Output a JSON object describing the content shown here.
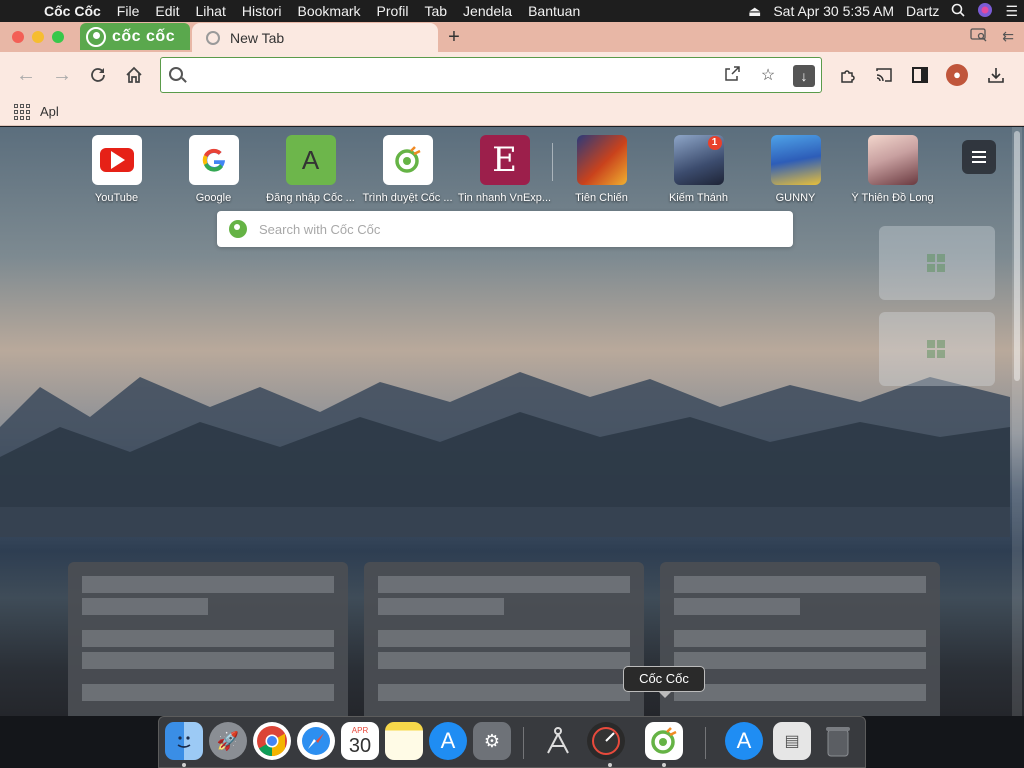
{
  "menubar": {
    "app_name": "Cốc Cốc",
    "items": [
      "File",
      "Edit",
      "Lihat",
      "Histori",
      "Bookmark",
      "Profil",
      "Tab",
      "Jendela",
      "Bantuan"
    ],
    "datetime": "Sat Apr 30  5:35 AM",
    "user": "Dartz"
  },
  "browser": {
    "brand_label": "cốc cốc",
    "tab_title": "New Tab",
    "address_value": "",
    "bookmark_apps_label": "Apl"
  },
  "new_tab": {
    "tiles": [
      {
        "label": "YouTube",
        "icon": "youtube-icon",
        "color": "#ffffff"
      },
      {
        "label": "Google",
        "icon": "google-icon",
        "color": "#ffffff"
      },
      {
        "label": "Đăng nhập Cốc ...",
        "letter": "A",
        "color": "#6db64b"
      },
      {
        "label": "Trình duyệt Cốc ...",
        "icon": "coccoc-icon",
        "color": "#ffffff"
      },
      {
        "label": "Tin nhanh VnExp...",
        "letter": "E",
        "color": "#9c1f4b"
      },
      {
        "label": "Tiên Chiến",
        "icon": "game-icon",
        "color": "#7a2a1a"
      },
      {
        "label": "Kiếm Thánh",
        "icon": "game-icon",
        "color": "#3c4c6e",
        "badge": "1"
      },
      {
        "label": "GUNNY",
        "icon": "game-icon",
        "color": "#2d5db8"
      },
      {
        "label": "Ý Thiên Đồ Long",
        "icon": "game-icon",
        "color": "#c8a0a0"
      }
    ],
    "search_placeholder": "Search with Cốc Cốc"
  },
  "dock": {
    "tooltip": "Cốc Cốc",
    "apps": [
      "Finder",
      "Launchpad",
      "Google Chrome",
      "Safari",
      "Calendar",
      "Notes",
      "App Store",
      "System Preferences",
      "Instruments",
      "Disk Diag",
      "Cốc Cốc",
      "App Store",
      "Preview",
      "Trash"
    ],
    "calendar_month": "APR",
    "calendar_day": "30"
  },
  "colors": {
    "brand_green": "#5aa84d",
    "tabstrip": "#e8b7a6",
    "toolbar": "#fbe9e1"
  }
}
